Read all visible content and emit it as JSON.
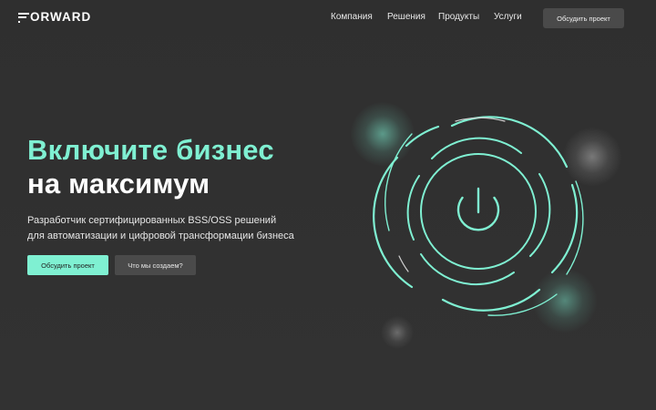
{
  "header": {
    "logo_text": "ORWARD",
    "nav": [
      "Компания",
      "Решения",
      "Продукты",
      "Услуги"
    ],
    "cta_label": "Обсудить проект"
  },
  "hero": {
    "title_line1": "Включите бизнес",
    "title_line2": "на максимум",
    "subtitle_line1": "Разработчик сертифицированных BSS/OSS решений",
    "subtitle_line2": "для автоматизации и цифровой трансформации бизнеса",
    "primary_button": "Обсудить проект",
    "secondary_button": "Что мы создаем?"
  },
  "colors": {
    "accent": "#7ff0d2",
    "background": "#303030",
    "button_dark": "#4a4a4a"
  },
  "icons": {
    "power": "power-icon"
  }
}
